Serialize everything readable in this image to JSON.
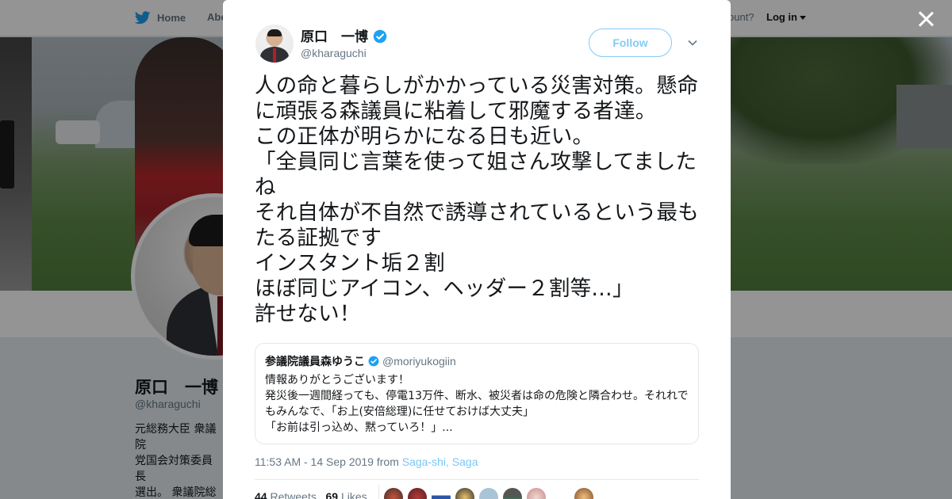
{
  "nav": {
    "home_label": "Home",
    "about_label": "Abo",
    "account_text": "ccount?",
    "login_label": "Log in"
  },
  "background_profile": {
    "name": "原口　一博",
    "handle": "@kharaguchi",
    "bio_lines": "元総務大臣 衆議院\n党国会対策委員長\n選出。 衆議院総務\n算委員会理事等を\nを守るために行動"
  },
  "tweet": {
    "author_name": "原口　一博",
    "author_handle": "@kharaguchi",
    "follow_label": "Follow",
    "text": "人の命と暮らしがかかっている災害対策。懸命に頑張る森議員に粘着して邪魔する者達。\nこの正体が明らかになる日も近い。\n「全員同じ言葉を使って姐さん攻撃してましたね\nそれ自体が不自然で誘導されているという最もたる証拠です\nインスタント垢２割\nほぼ同じアイコン、ヘッダー２割等…」\n許せない！",
    "quote": {
      "name": "参議院議員森ゆうこ",
      "handle": "@moriyukogiin",
      "text": "情報ありがとうございます！\n発災後一週間経っても、停電13万件、断水、被災者は命の危険と隣合わせ。それれでもみんなで、「お上(安倍総理)に任せておけば大丈夫」\n「お前は引っ込め、黙っていろ！」..."
    },
    "timestamp": "11:53 AM - 14 Sep 2019 from",
    "location": "Saga-shi, Saga",
    "retweets_count": "44",
    "retweets_label": "Retweets",
    "likes_count": "69",
    "likes_label": "Likes"
  },
  "colors": {
    "accent": "#1da1f2",
    "text": "#14171a",
    "muted": "#657786"
  },
  "icons": [
    "twitter-bird-icon",
    "verified-badge-icon",
    "chevron-down-icon",
    "close-icon"
  ]
}
